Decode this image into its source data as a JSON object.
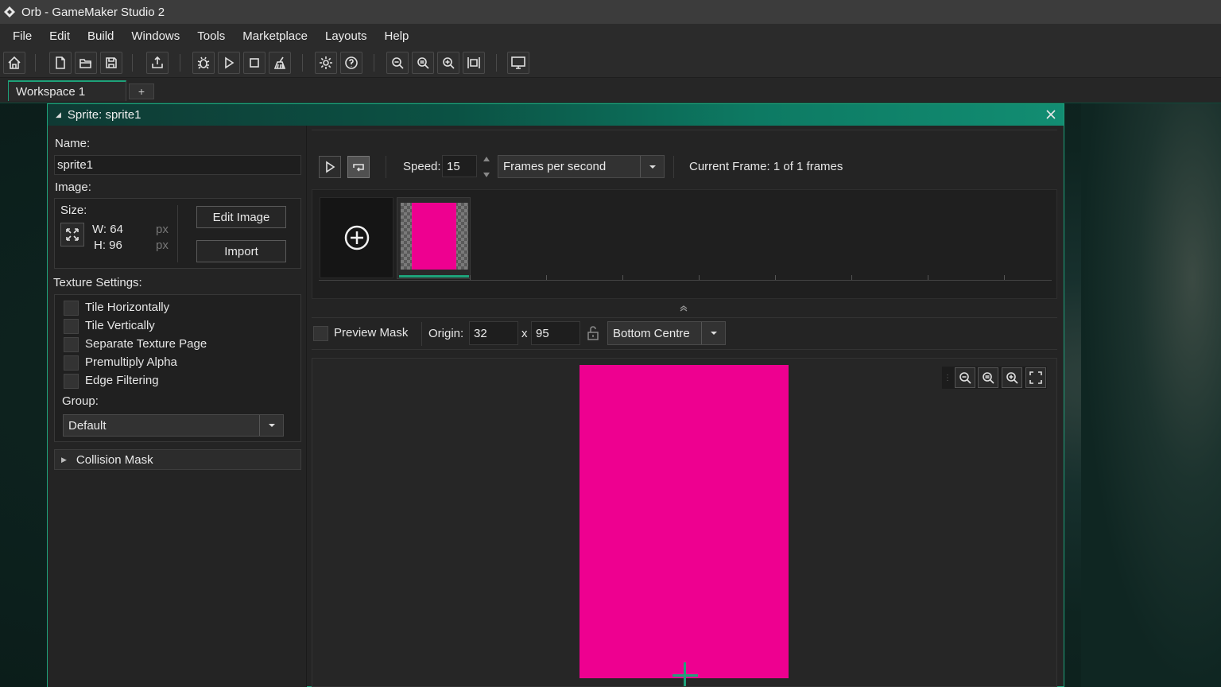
{
  "app": {
    "title": "Orb - GameMaker Studio 2"
  },
  "menu": [
    "File",
    "Edit",
    "Build",
    "Windows",
    "Tools",
    "Marketplace",
    "Layouts",
    "Help"
  ],
  "workspace": {
    "tab_label": "Workspace 1",
    "add_tab_label": "+"
  },
  "sprite_window": {
    "title": "Sprite: sprite1",
    "name_label": "Name:",
    "name_value": "sprite1",
    "image_label": "Image:",
    "size_label": "Size:",
    "width_text": "W: 64",
    "height_text": "H: 96",
    "px_unit": "px",
    "edit_image_label": "Edit Image",
    "import_label": "Import",
    "texture_settings_label": "Texture Settings:",
    "texture_options": [
      {
        "label": "Tile Horizontally",
        "checked": false
      },
      {
        "label": "Tile Vertically",
        "checked": false
      },
      {
        "label": "Separate Texture Page",
        "checked": false
      },
      {
        "label": "Premultiply Alpha",
        "checked": false
      },
      {
        "label": "Edge Filtering",
        "checked": false
      }
    ],
    "group_label": "Group:",
    "group_value": "Default",
    "collision_mask_label": "Collision Mask"
  },
  "playback": {
    "speed_label": "Speed:",
    "speed_value": "15",
    "speed_unit": "Frames per second",
    "current_frame_text": "Current Frame: 1 of 1 frames"
  },
  "origin_bar": {
    "preview_mask_label": "Preview Mask",
    "origin_label": "Origin:",
    "origin_x": "32",
    "x_sep": "x",
    "origin_y": "95",
    "origin_preset": "Bottom Centre"
  },
  "colors": {
    "accent": "#1ea27a",
    "sprite_fill": "#ee0090",
    "panel_bg": "#242424"
  }
}
